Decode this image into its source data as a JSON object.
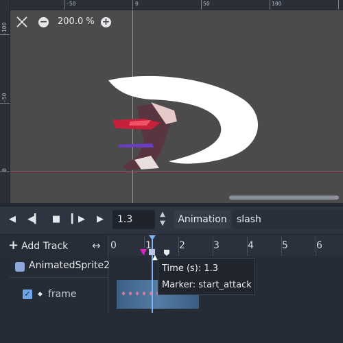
{
  "viewport": {
    "zoom_label": "200.0 %",
    "ruler_top_labels": [
      "-50",
      "0",
      "50",
      "100"
    ],
    "ruler_left_labels": [
      "-100",
      "-50",
      "0"
    ],
    "icons": [
      "center-view-icon",
      "zoom-out-icon",
      "zoom-in-icon"
    ]
  },
  "transport": {
    "time_value": "1.3",
    "animation_label": "Animation",
    "animation_name": "slash"
  },
  "tracks": {
    "add_track_label": "Add Track",
    "timeline_numbers": [
      "0",
      "1",
      "2",
      "3",
      "4",
      "5",
      "6"
    ],
    "node_name": "AnimatedSprite2",
    "property_name": "frame",
    "property_enabled": true
  },
  "tooltip": {
    "time_line": "Time (s): 1.3",
    "marker_line": "Marker: start_attack"
  },
  "colors": {
    "playhead": "#7fb2f0",
    "marker_selected": "#b8c7e6",
    "marker_pink": "#e021c8",
    "accent": "#6fa4e8"
  }
}
